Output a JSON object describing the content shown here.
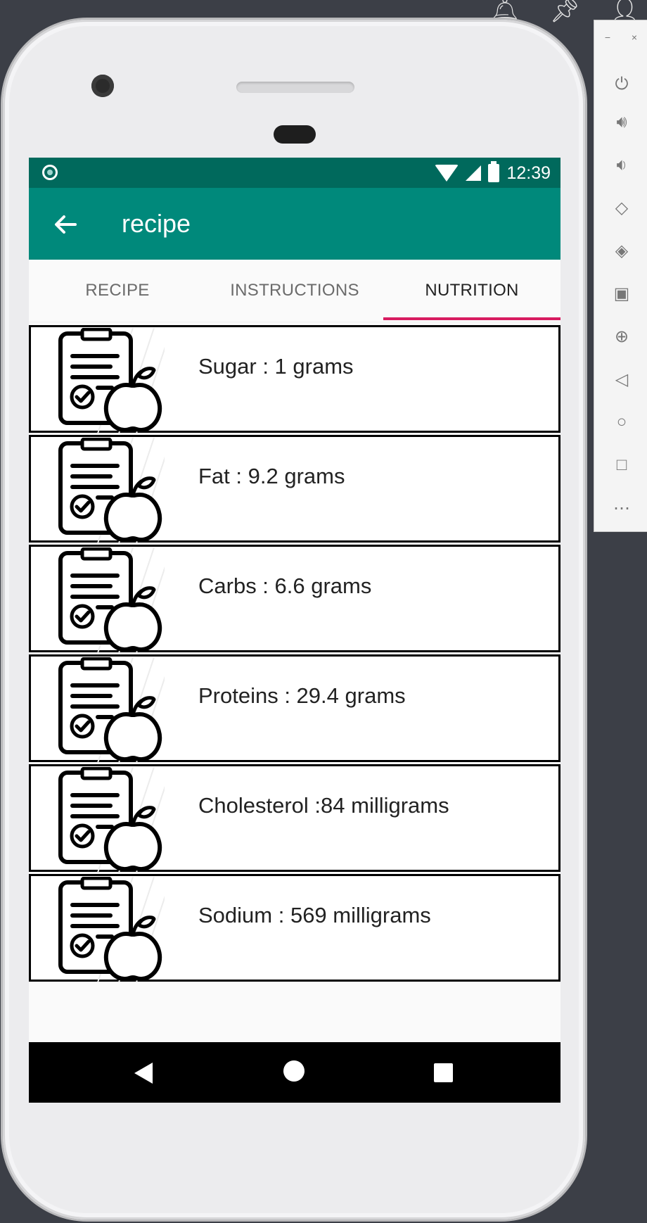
{
  "app_title": "recipe",
  "status_bar": {
    "time": "12:39"
  },
  "tabs": [
    {
      "label": "RECIPE",
      "active": false
    },
    {
      "label": "INSTRUCTIONS",
      "active": false
    },
    {
      "label": "NUTRITION",
      "active": true
    }
  ],
  "nutrition": [
    {
      "text": "Sugar : 1 grams",
      "icon": "clipboard-apple-icon"
    },
    {
      "text": "Fat : 9.2 grams",
      "icon": "clipboard-apple-icon"
    },
    {
      "text": "Carbs : 6.6 grams",
      "icon": "clipboard-apple-icon"
    },
    {
      "text": "Proteins : 29.4 grams",
      "icon": "clipboard-apple-icon"
    },
    {
      "text": "Cholesterol :84 milligrams",
      "icon": "clipboard-apple-icon"
    },
    {
      "text": "Sodium : 569 milligrams",
      "icon": "clipboard-apple-icon"
    }
  ],
  "colors": {
    "status_bar": "#00695c",
    "app_bar": "#00897b",
    "tab_indicator": "#d81b60"
  },
  "emulator_panel": {
    "window_buttons": [
      "−",
      "×"
    ],
    "icons": [
      "power-icon",
      "volume-up-icon",
      "volume-down-icon",
      "rotate-left-icon",
      "rotate-right-icon",
      "camera-icon",
      "zoom-icon",
      "back-icon",
      "home-icon",
      "overview-icon",
      "more-icon"
    ]
  }
}
